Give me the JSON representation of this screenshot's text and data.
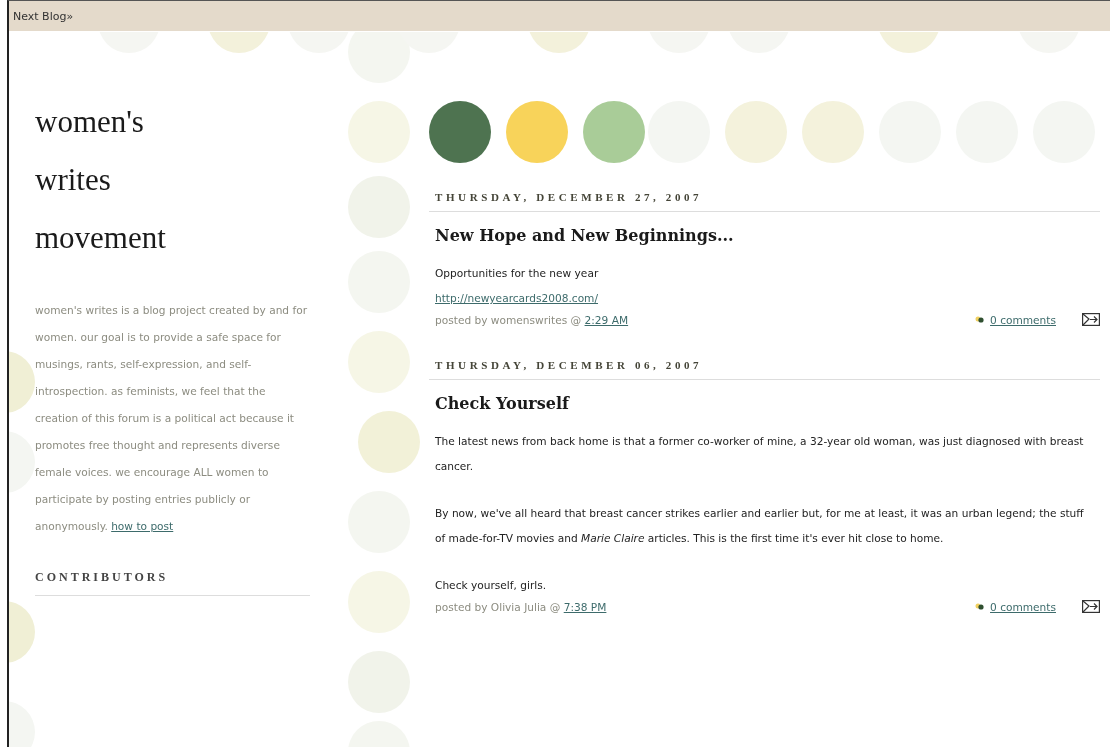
{
  "top_bar": {
    "next_blog": "Next Blog»"
  },
  "sidebar": {
    "title_lines": [
      "women's",
      "writes",
      "movement"
    ],
    "description": "women's writes is a blog project created by and for women. our goal is to provide a safe space for musings, rants, self-expression, and self-introspection. as feminists, we feel that the creation of this forum is a political act because it promotes free thought and represents diverse female voices. we encourage ALL women to participate by posting entries publicly or anonymously.",
    "description_link": "how to post",
    "section_heading": "CONTRIBUTORS"
  },
  "posts": [
    {
      "date": "THURSDAY, DECEMBER 27, 2007",
      "title": "New Hope and New Beginnings...",
      "body": [
        {
          "kind": "text",
          "text": "Opportunities for the new year"
        },
        {
          "kind": "link",
          "text": "http://newyearcards2008.com/"
        }
      ],
      "posted_by": "posted by womenswrites @",
      "time": "2:29 AM",
      "comments": "0 comments"
    },
    {
      "date": "THURSDAY, DECEMBER 06, 2007",
      "title": "Check Yourself",
      "body": [
        {
          "kind": "text",
          "text": "The latest news from back home is that a former co-worker of mine, a 32-year old woman, was just diagnosed with breast cancer."
        },
        {
          "kind": "text",
          "text": "By now, we've all heard that breast cancer strikes earlier and earlier but, for me at least, it was an urban legend; the stuff of made-for-TV movies and *Marie Claire* articles. This is the first time it's ever hit close to home."
        },
        {
          "kind": "text",
          "text": "Check yourself, girls."
        }
      ],
      "posted_by": "posted by Olivia Julia @",
      "time": "7:38 PM",
      "comments": "0 comments"
    }
  ]
}
